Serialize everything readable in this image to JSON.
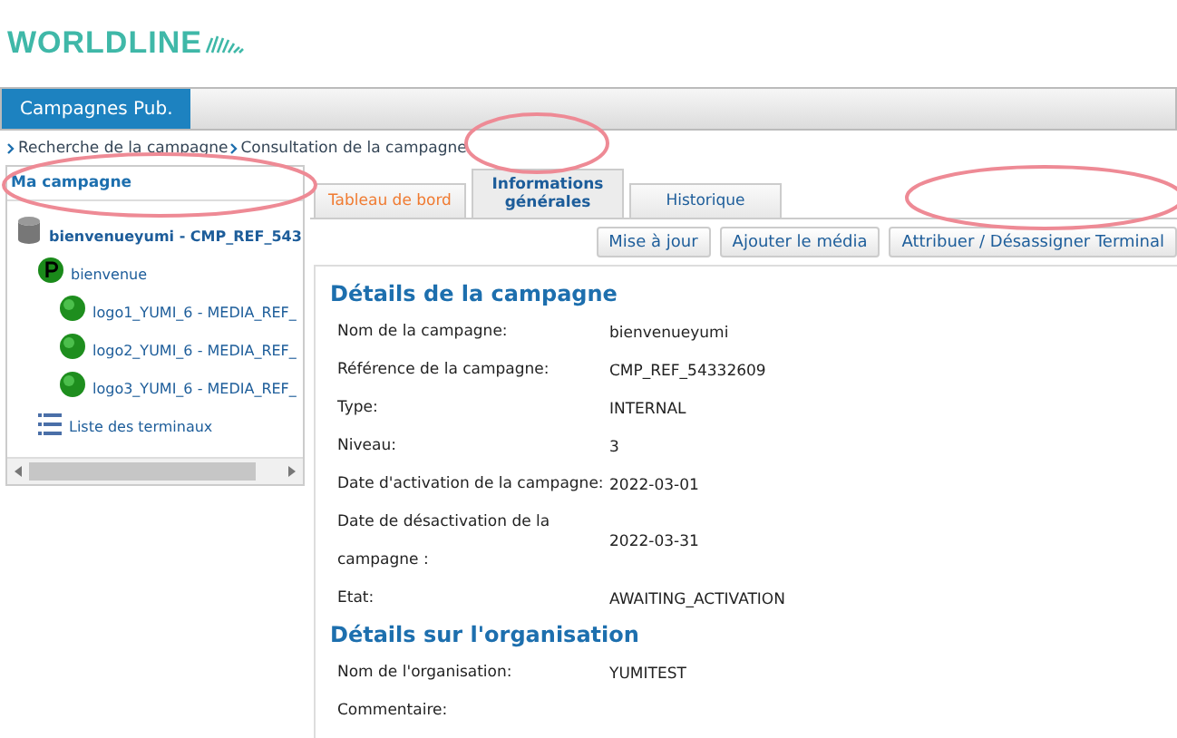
{
  "logo": {
    "text": "WORLDLINE"
  },
  "nav": {
    "tabs": [
      {
        "label": "Campagnes Pub.",
        "selected": true
      }
    ]
  },
  "breadcrumb": [
    "Recherche de la campagne",
    "Consultation de la campagne"
  ],
  "sidebar": {
    "title": "Ma campagne",
    "tree": [
      {
        "kind": "campaign",
        "label": "bienvenueyumi - CMP_REF_543",
        "children": [
          {
            "kind": "playlist",
            "label": "bienvenue",
            "children": [
              {
                "kind": "media",
                "label": "logo1_YUMI_6 - MEDIA_REF_"
              },
              {
                "kind": "media",
                "label": "logo2_YUMI_6 - MEDIA_REF_"
              },
              {
                "kind": "media",
                "label": "logo3_YUMI_6 - MEDIA_REF_"
              }
            ]
          },
          {
            "kind": "list",
            "label": "Liste des terminaux"
          }
        ]
      }
    ]
  },
  "tabs": [
    {
      "label": "Tableau de bord",
      "selected": false
    },
    {
      "label": "Informations générales",
      "selected": true
    },
    {
      "label": "Historique",
      "selected": false
    }
  ],
  "buttons": [
    "Mise à jour",
    "Ajouter le média",
    "Attribuer / Désassigner Terminal"
  ],
  "sections": [
    {
      "title": "Détails de la campagne",
      "fields": [
        {
          "label": "Nom de la campagne:",
          "value": "bienvenueyumi"
        },
        {
          "label": "Référence de la campagne:",
          "value": "CMP_REF_54332609"
        },
        {
          "label": "Type:",
          "value": "INTERNAL"
        },
        {
          "label": "Niveau:",
          "value": "3"
        },
        {
          "label": "Date d'activation de la campagne:",
          "value": "2022-03-01"
        },
        {
          "label": "Date de désactivation de la campagne :",
          "value": "2022-03-31"
        },
        {
          "label": "Etat:",
          "value": "AWAITING_ACTIVATION"
        }
      ]
    },
    {
      "title": "Détails sur l'organisation",
      "fields": [
        {
          "label": "Nom de l'organisation:",
          "value": "YUMITEST"
        },
        {
          "label": "Commentaire:"
        }
      ]
    }
  ]
}
